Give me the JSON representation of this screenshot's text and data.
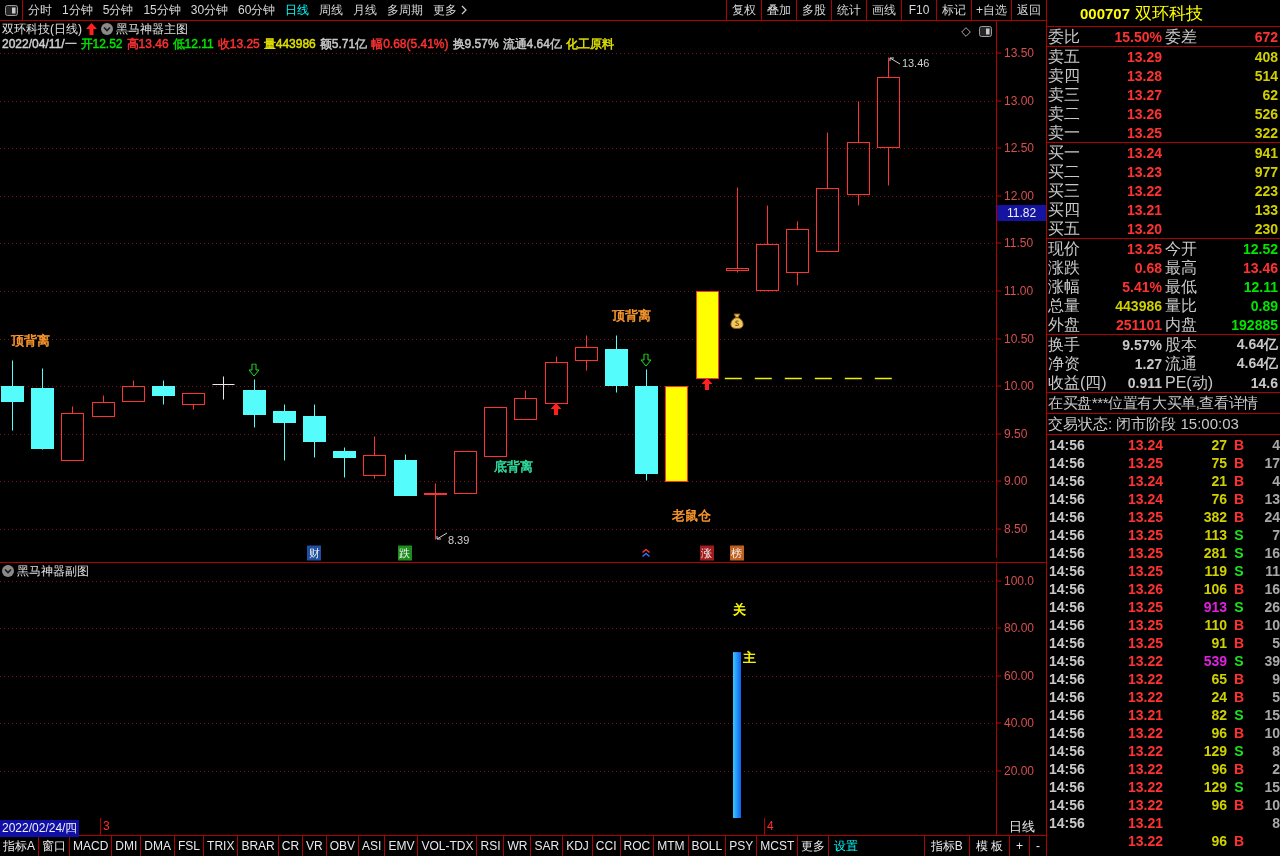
{
  "toolbar": {
    "period_tabs": [
      {
        "label": "分时",
        "selected": false
      },
      {
        "label": "1分钟",
        "selected": false
      },
      {
        "label": "5分钟",
        "selected": false
      },
      {
        "label": "15分钟",
        "selected": false
      },
      {
        "label": "30分钟",
        "selected": false
      },
      {
        "label": "60分钟",
        "selected": false
      },
      {
        "label": "日线",
        "selected": true
      },
      {
        "label": "周线",
        "selected": false
      },
      {
        "label": "月线",
        "selected": false
      },
      {
        "label": "多周期",
        "selected": false
      }
    ],
    "more": "更多",
    "buttons": [
      "复权",
      "叠加",
      "多股",
      "统计",
      "画线",
      "F10",
      "标记",
      "+自选",
      "返回"
    ]
  },
  "main_chart": {
    "title": "双环科技(日线)",
    "indicator": "黑马神器主图",
    "date": "2022/04/11/一",
    "quote_fields": [
      {
        "text": "开12.52",
        "color": "#00e600"
      },
      {
        "text": "高13.46",
        "color": "#ff3232"
      },
      {
        "text": "低12.11",
        "color": "#00e600"
      },
      {
        "text": "收13.25",
        "color": "#ff3232"
      },
      {
        "text": "量443986",
        "color": "#e0e000"
      },
      {
        "text": "额5.71亿",
        "color": "#c8c8c8"
      },
      {
        "text": "幅0.68(5.41%)",
        "color": "#ff3232"
      },
      {
        "text": "换9.57%",
        "color": "#c8c8c8"
      },
      {
        "text": "流通4.64亿",
        "color": "#c8c8c8"
      },
      {
        "text": "化工原料",
        "color": "#e0e000"
      }
    ],
    "price_axis": [
      "13.50",
      "13.00",
      "12.50",
      "12.00",
      "11.50",
      "11.00",
      "10.50",
      "10.00",
      "9.50",
      "9.00",
      "8.50"
    ],
    "cursor_price": "11.82",
    "high_label": "13.46",
    "low_label": "8.39",
    "signals": [
      {
        "text": "顶背离",
        "color": "#ff9a2e"
      },
      {
        "text": "顶背离",
        "color": "#ff9a2e"
      },
      {
        "text": "底背离",
        "color": "#30e0a0"
      },
      {
        "text": "老鼠仓",
        "color": "#ff9a2e"
      }
    ],
    "events": [
      {
        "text": "财",
        "color": "#1f4fa0"
      },
      {
        "text": "跌",
        "color": "#1c8c1c"
      },
      {
        "text": "涨",
        "color": "#a01c1c"
      },
      {
        "text": "榜",
        "color": "#c0601c"
      }
    ]
  },
  "sub_chart": {
    "indicator": "黑马神器副图",
    "chart_data": {
      "type": "bar",
      "values": [
        70
      ],
      "grid": true,
      "ylim": [
        0,
        107.6
      ],
      "yticks": [
        {
          "value": 20,
          "label": "20.00"
        },
        {
          "value": 40,
          "label": "40.00"
        },
        {
          "value": 60,
          "label": "60.00"
        },
        {
          "value": 80,
          "label": "80.00"
        },
        {
          "value": 100,
          "label": "100.0"
        }
      ]
    },
    "signals": [
      "关",
      "主"
    ],
    "cursor_date": "2022/02/24/四",
    "month_marks": [
      "3",
      "4"
    ],
    "period": "日线"
  },
  "indicator_bar": {
    "tabs": [
      "指标A",
      "窗口",
      "MACD",
      "DMI",
      "DMA",
      "FSL",
      "TRIX",
      "BRAR",
      "CR",
      "VR",
      "OBV",
      "ASI",
      "EMV",
      "VOL-TDX",
      "RSI",
      "WR",
      "SAR",
      "KDJ",
      "CCI",
      "ROC",
      "MTM",
      "BOLL",
      "PSY",
      "MCST",
      "更多"
    ],
    "settings": "设置",
    "right_buttons": [
      "指标B",
      "模 板",
      "+",
      "-"
    ]
  },
  "quote_panel": {
    "code": "000707",
    "name": "双环科技",
    "ratio": {
      "label": "委比",
      "value": "15.50%",
      "diff_label": "委差",
      "diff_value": "672"
    },
    "asks": [
      {
        "label": "卖五",
        "price": "13.29",
        "volume": "408"
      },
      {
        "label": "卖四",
        "price": "13.28",
        "volume": "514"
      },
      {
        "label": "卖三",
        "price": "13.27",
        "volume": "62"
      },
      {
        "label": "卖二",
        "price": "13.26",
        "volume": "526"
      },
      {
        "label": "卖一",
        "price": "13.25",
        "volume": "322"
      }
    ],
    "bids": [
      {
        "label": "买一",
        "price": "13.24",
        "volume": "941"
      },
      {
        "label": "买二",
        "price": "13.23",
        "volume": "977"
      },
      {
        "label": "买三",
        "price": "13.22",
        "volume": "223"
      },
      {
        "label": "买四",
        "price": "13.21",
        "volume": "133"
      },
      {
        "label": "买五",
        "price": "13.20",
        "volume": "230"
      }
    ],
    "stats": [
      {
        "label": "现价",
        "value": "13.25",
        "color": "#ff3232"
      },
      {
        "label": "今开",
        "value": "12.52",
        "color": "#00e600"
      },
      {
        "label": "涨跌",
        "value": "0.68",
        "color": "#ff3232"
      },
      {
        "label": "最高",
        "value": "13.46",
        "color": "#ff3232"
      },
      {
        "label": "涨幅",
        "value": "5.41%",
        "color": "#ff3232"
      },
      {
        "label": "最低",
        "value": "12.11",
        "color": "#00e600"
      },
      {
        "label": "总量",
        "value": "443986",
        "color": "#d0d000"
      },
      {
        "label": "量比",
        "value": "0.89",
        "color": "#00e600"
      },
      {
        "label": "外盘",
        "value": "251101",
        "color": "#ff3232"
      },
      {
        "label": "内盘",
        "value": "192885",
        "color": "#00e600"
      }
    ],
    "fundamentals": [
      {
        "label": "换手",
        "value": "9.57%"
      },
      {
        "label": "股本",
        "value": "4.64亿"
      },
      {
        "label": "净资",
        "value": "1.27"
      },
      {
        "label": "流通",
        "value": "4.64亿"
      },
      {
        "label": "收益(四)",
        "value": "0.911"
      },
      {
        "label": "PE(动)",
        "value": "14.6"
      }
    ],
    "notice": "在买盘***位置有大买单,查看详情",
    "status": "交易状态: 闭市阶段 15:00:03",
    "trades": [
      {
        "time": "14:56",
        "price": "13.24",
        "volume": "27",
        "side": "B",
        "kind": "buy",
        "big": false,
        "count": "4"
      },
      {
        "time": "14:56",
        "price": "13.25",
        "volume": "75",
        "side": "B",
        "kind": "buy",
        "big": false,
        "count": "17"
      },
      {
        "time": "14:56",
        "price": "13.24",
        "volume": "21",
        "side": "B",
        "kind": "buy",
        "big": false,
        "count": "4"
      },
      {
        "time": "14:56",
        "price": "13.24",
        "volume": "76",
        "side": "B",
        "kind": "buy",
        "big": false,
        "count": "13"
      },
      {
        "time": "14:56",
        "price": "13.25",
        "volume": "382",
        "side": "B",
        "kind": "buy",
        "big": false,
        "count": "24"
      },
      {
        "time": "14:56",
        "price": "13.25",
        "volume": "113",
        "side": "S",
        "kind": "sell",
        "big": false,
        "count": "7"
      },
      {
        "time": "14:56",
        "price": "13.25",
        "volume": "281",
        "side": "S",
        "kind": "sell",
        "big": false,
        "count": "16"
      },
      {
        "time": "14:56",
        "price": "13.25",
        "volume": "119",
        "side": "S",
        "kind": "sell",
        "big": false,
        "count": "11"
      },
      {
        "time": "14:56",
        "price": "13.26",
        "volume": "106",
        "side": "B",
        "kind": "buy",
        "big": false,
        "count": "16"
      },
      {
        "time": "14:56",
        "price": "13.25",
        "volume": "913",
        "side": "S",
        "kind": "sell",
        "big": true,
        "count": "26"
      },
      {
        "time": "14:56",
        "price": "13.25",
        "volume": "110",
        "side": "B",
        "kind": "buy",
        "big": false,
        "count": "10"
      },
      {
        "time": "14:56",
        "price": "13.25",
        "volume": "91",
        "side": "B",
        "kind": "buy",
        "big": false,
        "count": "5"
      },
      {
        "time": "14:56",
        "price": "13.22",
        "volume": "539",
        "side": "S",
        "kind": "sell",
        "big": true,
        "count": "39"
      },
      {
        "time": "14:56",
        "price": "13.22",
        "volume": "65",
        "side": "B",
        "kind": "buy",
        "big": false,
        "count": "9"
      },
      {
        "time": "14:56",
        "price": "13.22",
        "volume": "24",
        "side": "B",
        "kind": "buy",
        "big": false,
        "count": "5"
      },
      {
        "time": "14:56",
        "price": "13.21",
        "volume": "82",
        "side": "S",
        "kind": "sell",
        "big": false,
        "count": "15"
      },
      {
        "time": "14:56",
        "price": "13.22",
        "volume": "96",
        "side": "B",
        "kind": "buy",
        "big": false,
        "count": "10"
      },
      {
        "time": "14:56",
        "price": "13.22",
        "volume": "129",
        "side": "S",
        "kind": "sell",
        "big": false,
        "count": "8"
      },
      {
        "time": "14:56",
        "price": "13.22",
        "volume": "96",
        "side": "B",
        "kind": "buy",
        "big": false,
        "count": "2"
      },
      {
        "time": "14:56",
        "price": "13.22",
        "volume": "129",
        "side": "S",
        "kind": "sell",
        "big": false,
        "count": "15"
      },
      {
        "time": "14:56",
        "price": "13.22",
        "volume": "96",
        "side": "B",
        "kind": "buy",
        "big": false,
        "count": "10"
      },
      {
        "time": "14:56",
        "price": "13.21",
        "count": "8"
      },
      {
        "price": "13.22",
        "volume": "96",
        "side": "B",
        "kind": "buy",
        "big": false
      }
    ]
  }
}
